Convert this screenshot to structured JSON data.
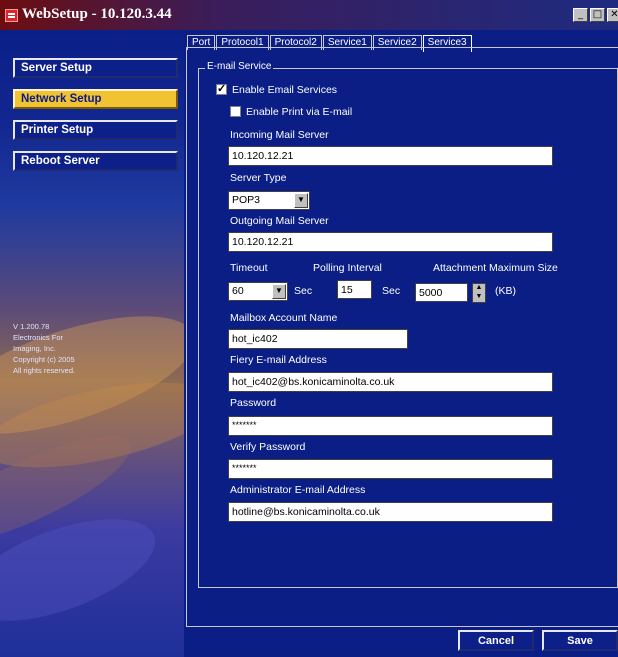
{
  "window": {
    "title": "WebSetup - 10.120.3.44"
  },
  "sidebar": {
    "items": [
      {
        "label": "Server Setup"
      },
      {
        "label": "Network Setup"
      },
      {
        "label": "Printer Setup"
      },
      {
        "label": "Reboot Server"
      }
    ],
    "active_index": 1,
    "version_lines": [
      "V 1.200.78",
      "Electronics For",
      "Imaging, Inc.",
      "Copyright (c) 2005",
      "All rights reserved."
    ]
  },
  "tabs": [
    {
      "label": "Port"
    },
    {
      "label": "Protocol1"
    },
    {
      "label": "Protocol2"
    },
    {
      "label": "Service1"
    },
    {
      "label": "Service2"
    },
    {
      "label": "Service3"
    }
  ],
  "active_tab": "Service3",
  "form": {
    "group_label": "E-mail Service",
    "enable_email": {
      "label": "Enable Email Services",
      "checked": true
    },
    "enable_print": {
      "label": "Enable Print via E-mail",
      "checked": false
    },
    "incoming_label": "Incoming Mail Server",
    "incoming_value": "10.120.12.21",
    "server_type_label": "Server Type",
    "server_type_value": "POP3",
    "outgoing_label": "Outgoing Mail Server",
    "outgoing_value": "10.120.12.21",
    "timeout_label": "Timeout",
    "timeout_value": "60",
    "timeout_unit": "Sec",
    "polling_label": "Polling Interval",
    "polling_value": "15",
    "polling_unit": "Sec",
    "attach_label": "Attachment Maximum Size",
    "attach_value": "5000",
    "attach_unit": "(KB)",
    "mailbox_label": "Mailbox Account Name",
    "mailbox_value": "hot_ic402",
    "fiery_label": "Fiery E-mail Address",
    "fiery_value": "hot_ic402@bs.konicaminolta.co.uk",
    "password_label": "Password",
    "password_value": "*******",
    "verify_label": "Verify Password",
    "verify_value": "*******",
    "admin_label": "Administrator E-mail Address",
    "admin_value": "hotline@bs.konicaminolta.co.uk"
  },
  "footer": {
    "cancel_label": "Cancel",
    "save_label": "Save"
  },
  "colors": {
    "background": "#0a1e86",
    "active_nav": "#f1c332",
    "title_bar_start": "#6c0e10"
  }
}
